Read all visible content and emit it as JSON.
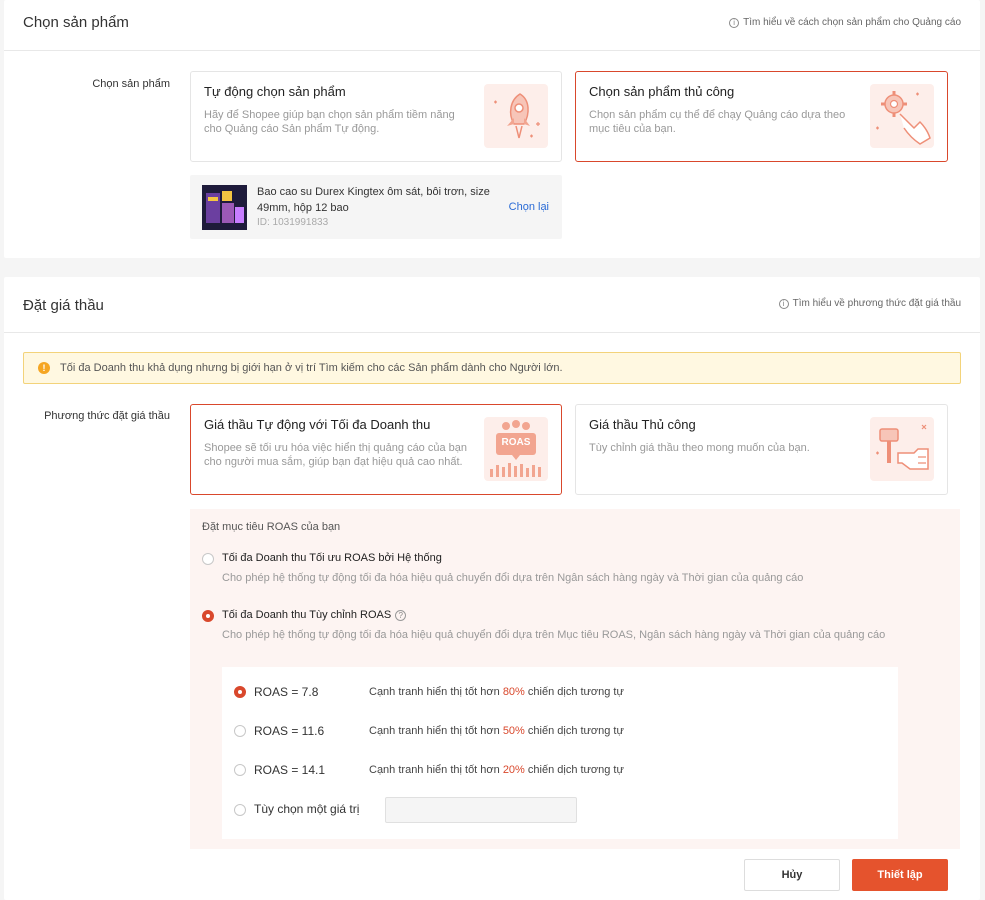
{
  "product_section": {
    "title": "Chọn sản phẩm",
    "help_link": "Tìm hiểu về cách chọn sản phẩm cho Quảng cáo",
    "row_label": "Chọn sản phẩm",
    "options": [
      {
        "title": "Tự động chọn sản phẩm",
        "desc": "Hãy để Shopee giúp bạn chọn sản phẩm tiềm năng cho Quảng cáo Sản phẩm Tự động.",
        "icon": "rocket-icon",
        "selected": false
      },
      {
        "title": "Chọn sản phẩm thủ công",
        "desc": "Chọn sản phẩm cụ thể để chạy Quảng cáo dựa theo mục tiêu của bạn.",
        "icon": "gear-hand-icon",
        "selected": true
      }
    ],
    "selected_product": {
      "name": "Bao cao su Durex Kingtex ôm sát, bôi trơn, size 49mm, hộp 12 bao",
      "id": "ID: 1031991833",
      "reselect": "Chọn lại"
    }
  },
  "bid_section": {
    "title": "Đặt giá thầu",
    "help_link": "Tìm hiểu về phương thức đặt giá thầu",
    "warning": "Tối đa Doanh thu khả dụng nhưng bị giới hạn ở vị trí Tìm kiếm cho các Sản phẩm dành cho Người lớn.",
    "row_label": "Phương thức đặt giá thầu",
    "options": [
      {
        "title": "Giá thầu Tự động với Tối đa Doanh thu",
        "desc": "Shopee sẽ tối ưu hóa việc hiển thị quảng cáo của bạn cho người mua sắm, giúp bạn đạt hiệu quả cao nhất.",
        "icon": "roas-icon",
        "icon_text": "ROAS",
        "selected": true
      },
      {
        "title": "Giá thầu Thủ công",
        "desc": "Tùy chỉnh giá thầu theo mong muốn của bạn.",
        "icon": "gavel-icon",
        "selected": false
      }
    ],
    "roas_heading": "Đặt mục tiêu ROAS của bạn",
    "modes": [
      {
        "title": "Tối đa Doanh thu Tối ưu ROAS bởi Hệ thống",
        "desc": "Cho phép hệ thống tự động tối đa hóa hiệu quả chuyển đổi dựa trên Ngân sách hàng ngày và Thời gian của quảng cáo",
        "checked": false
      },
      {
        "title": "Tối đa Doanh thu Tùy chỉnh ROAS",
        "desc": "Cho phép hệ thống tự động tối đa hóa hiệu quả chuyển đổi dựa trên Mục tiêu ROAS, Ngân sách hàng ngày và Thời gian của quảng cáo",
        "checked": true
      }
    ],
    "roas_options": [
      {
        "label": "ROAS = 7.8",
        "desc_pre": "Cạnh tranh hiển thị tốt hơn ",
        "pct": "80%",
        "desc_post": " chiến dịch tương tự",
        "checked": true
      },
      {
        "label": "ROAS = 11.6",
        "desc_pre": "Cạnh tranh hiển thị tốt hơn ",
        "pct": "50%",
        "desc_post": " chiến dịch tương tự",
        "checked": false
      },
      {
        "label": "ROAS = 14.1",
        "desc_pre": "Cạnh tranh hiển thị tốt hơn ",
        "pct": "20%",
        "desc_post": " chiến dịch tương tự",
        "checked": false
      }
    ],
    "custom_option": {
      "label": "Tùy chọn một giá trị",
      "value": "",
      "checked": false
    }
  },
  "footer": {
    "cancel": "Hủy",
    "submit": "Thiết lập"
  },
  "colors": {
    "accent": "#d9482c",
    "button": "#e5532d",
    "link": "#2a6bd6",
    "warning_bg": "#fff8e1"
  }
}
